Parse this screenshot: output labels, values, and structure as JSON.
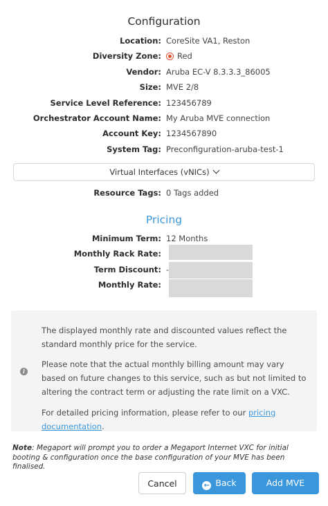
{
  "configuration": {
    "title": "Configuration",
    "fields": [
      {
        "label": "Location:",
        "value": "CoreSite VA1, Reston"
      },
      {
        "label": "Diversity Zone:",
        "value": "Red"
      },
      {
        "label": "Vendor:",
        "value": "Aruba EC-V 8.3.3.3_86005"
      },
      {
        "label": "Size:",
        "value": "MVE 2/8"
      },
      {
        "label": "Service Level Reference:",
        "value": "123456789"
      },
      {
        "label": "Orchestrator Account Name:",
        "value": "My Aruba MVE connection"
      },
      {
        "label": "Account Key:",
        "value": "1234567890"
      },
      {
        "label": "System Tag:",
        "value": "Preconfiguration-aruba-test-1"
      }
    ],
    "diversity_zone_color": "#e0542f",
    "vnics_toggle": "Virtual Interfaces (vNICs)",
    "resource_tags": {
      "label": "Resource Tags:",
      "value": "0 Tags added"
    }
  },
  "pricing": {
    "title": "Pricing",
    "minimum_term": {
      "label": "Minimum Term:",
      "value": "12 Months"
    },
    "monthly_rack_rate": {
      "label": "Monthly Rack Rate:"
    },
    "term_discount": {
      "label": "Term Discount:",
      "prefix": "-"
    },
    "monthly_rate": {
      "label": "Monthly Rate:"
    }
  },
  "info": {
    "p1": "The displayed monthly rate and discounted values reflect the standard monthly price for the service.",
    "p2": "Please note that the actual monthly billing amount may vary based on future changes to this service, such as but not limited to altering the contract term or adjusting the rate limit on a VXC.",
    "p3_prefix": "For detailed pricing information, please refer to our ",
    "p3_link": "pricing documentation",
    "p3_suffix": "."
  },
  "note": {
    "bold": "Note",
    "text": ": Megaport will prompt you to order a Megaport Internet VXC for initial booting & configuration once the base configuration of your MVE has been finalised."
  },
  "buttons": {
    "cancel": "Cancel",
    "back": "Back",
    "add": "Add MVE"
  },
  "colors": {
    "accent": "#3b97dc",
    "diversity_red": "#e0542f"
  }
}
